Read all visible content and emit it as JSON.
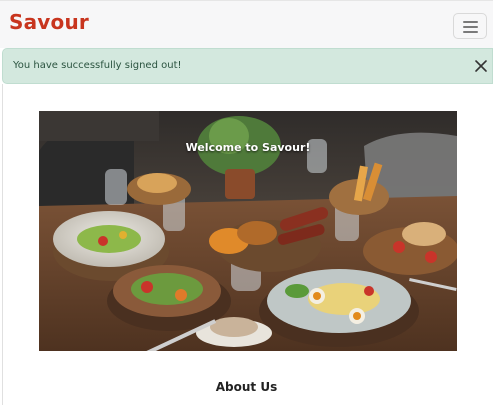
{
  "navbar": {
    "brand": "Savour",
    "menu_icon": "hamburger-menu-icon"
  },
  "alert": {
    "message": "You have successfully signed out!",
    "close_icon": "close-icon"
  },
  "hero": {
    "title": "Welcome to Savour!"
  },
  "about": {
    "heading": "About Us"
  },
  "colors": {
    "brand": "#c8351e",
    "alert_bg": "#d3e8de",
    "alert_text": "#2b5440",
    "navbar_bg": "#f7f7f8"
  }
}
